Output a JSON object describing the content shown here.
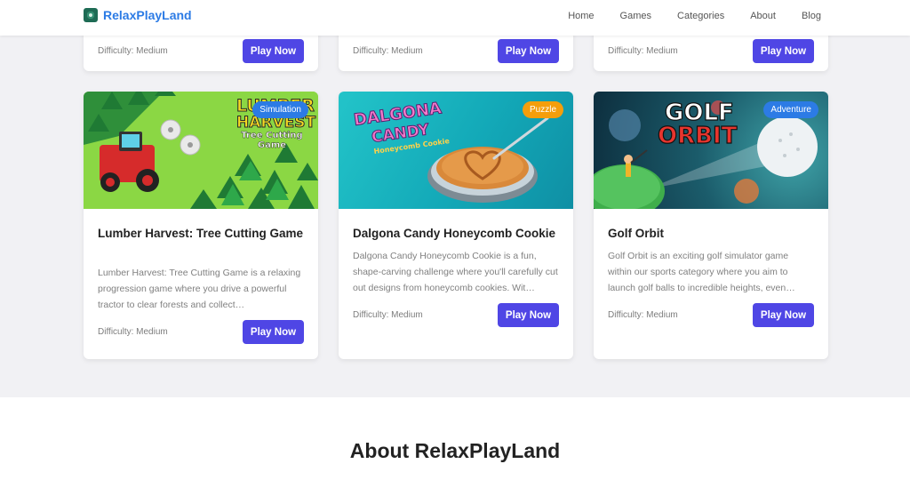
{
  "header": {
    "site_name": "RelaxPlayLand",
    "nav": [
      "Home",
      "Games",
      "Categories",
      "About",
      "Blog"
    ]
  },
  "top_row_cards": [
    {
      "difficulty": "Difficulty: Medium",
      "button": "Play Now"
    },
    {
      "difficulty": "Difficulty: Medium",
      "button": "Play Now"
    },
    {
      "difficulty": "Difficulty: Medium",
      "button": "Play Now"
    }
  ],
  "games": [
    {
      "title": "Lumber Harvest: Tree Cutting Game",
      "category": "Simulation",
      "category_color": "#2c7be5",
      "thumb_text": [
        "LUMBER",
        "HARVEST",
        "Tree Cutting",
        "Game"
      ],
      "description": "Lumber Harvest: Tree Cutting Game is a relaxing progression game where you drive a powerful tractor to clear forests and collect…",
      "difficulty": "Difficulty: Medium",
      "button": "Play Now"
    },
    {
      "title": "Dalgona Candy Honeycomb Cookie",
      "category": "Puzzle",
      "category_color": "#f59e0b",
      "thumb_text": [
        "DALGONA",
        "CANDY",
        "Honeycomb Cookie"
      ],
      "description": "Dalgona Candy Honeycomb Cookie is a fun, shape-carving challenge where you'll carefully cut out designs from honeycomb cookies. Wit…",
      "difficulty": "Difficulty: Medium",
      "button": "Play Now"
    },
    {
      "title": "Golf Orbit",
      "category": "Adventure",
      "category_color": "#2c7be5",
      "thumb_text": [
        "GOLF",
        "ORBIT"
      ],
      "description": "Golf Orbit is an exciting golf simulator game within our sports category where you aim to launch golf balls to incredible heights, even…",
      "difficulty": "Difficulty: Medium",
      "button": "Play Now"
    }
  ],
  "about": {
    "title": "About RelaxPlayLand"
  }
}
